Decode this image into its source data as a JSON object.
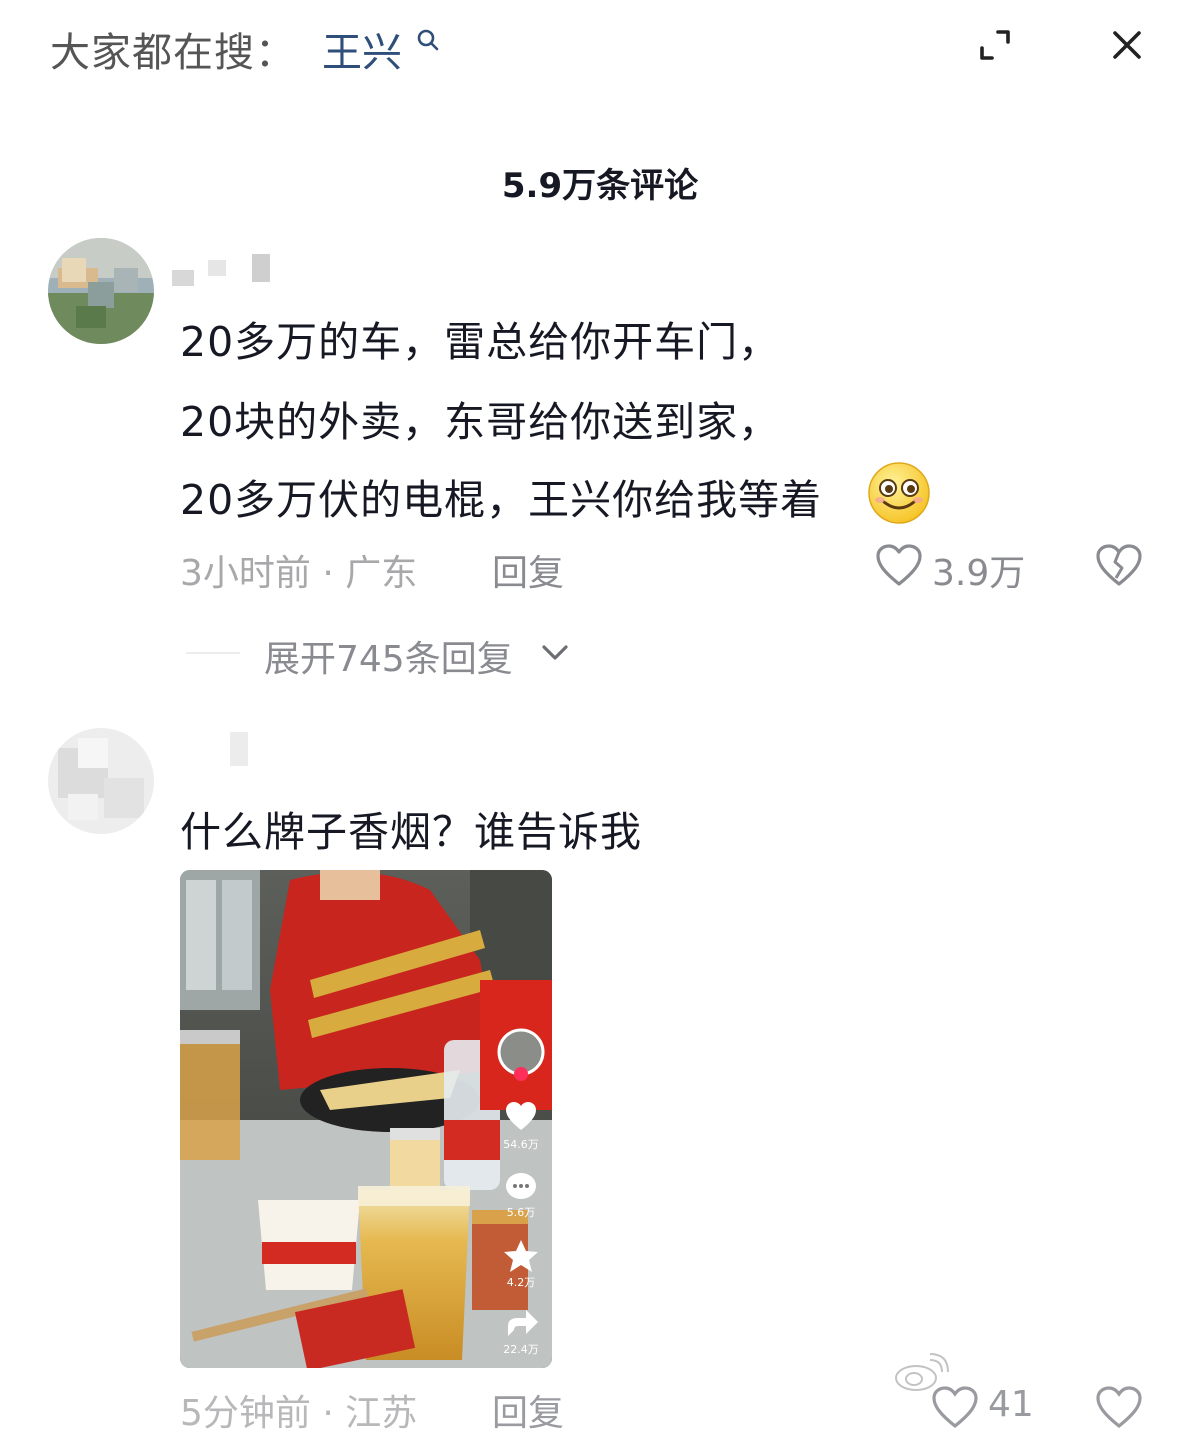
{
  "header": {
    "search_prefix": "大家都在搜：",
    "search_term": "王兴",
    "icons": [
      "search-icon",
      "expand-icon",
      "close-icon"
    ]
  },
  "comment_count": "5.9万条评论",
  "comments": [
    {
      "lines": [
        "20多万的车，雷总给你开车门，",
        "20块的外卖，东哥给你送到家，",
        "20多万伏的电棍，王兴你给我等着"
      ],
      "emoji": "smile-emoji",
      "time_location": "3小时前 · 广东",
      "reply_label": "回复",
      "like_count": "3.9万",
      "expand_replies": "展开745条回复"
    },
    {
      "text": "什么牌子香烟？谁告诉我",
      "image_overlay": {
        "likes": "54.6万",
        "comments": "5.6万",
        "favorites": "4.2万",
        "shares": "22.4万"
      },
      "time_location": "5分钟前 · 江苏",
      "reply_label": "回复",
      "like_count": "41"
    }
  ],
  "colors": {
    "search_term": "#2f4e7a",
    "meta_gray": "#a8a8ab",
    "text": "#161823"
  }
}
